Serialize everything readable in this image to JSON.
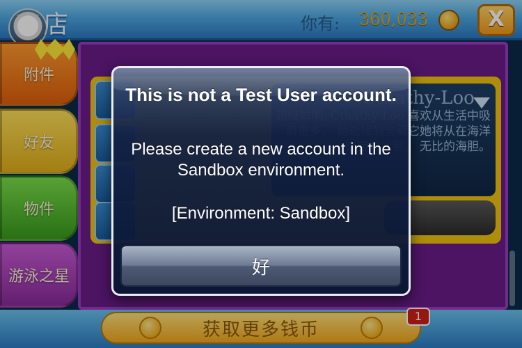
{
  "header": {
    "title": "商店",
    "coins_label": "你有:",
    "coins_value": "360,033",
    "close_label": "X"
  },
  "sidebar": {
    "items": [
      {
        "label": "附件"
      },
      {
        "label": "好友"
      },
      {
        "label": "物件"
      },
      {
        "label": "游泳之星"
      }
    ]
  },
  "detail": {
    "name": "Cthathy-Loo",
    "description": "超级聪明, Cthathy-Loo 喜欢从生活中吸取更多。 她能找到宝藏它她将从在海洋宝宝内找到。 无比的海胆。"
  },
  "footer": {
    "more_coins_label": "获取更多钱币",
    "notification_count": "1"
  },
  "alert": {
    "title": "This is not a Test User account.",
    "message": "Please create a new account in the Sandbox environment.",
    "environment": "[Environment: Sandbox]",
    "ok_label": "好"
  },
  "colors": {
    "alert_bg": "#12244a",
    "panel_purple": "#6a1d8a",
    "gold": "#f1c40f"
  },
  "icons": [
    "home-icon",
    "coin-icon",
    "close-icon",
    "dropdown-arrow-icon",
    "smiley-icon"
  ]
}
